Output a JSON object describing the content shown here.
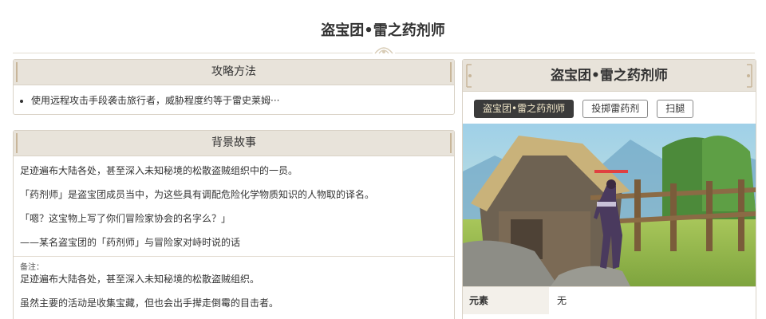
{
  "page": {
    "title": "盗宝团•雷之药剂师"
  },
  "strategy": {
    "header": "攻略方法",
    "items": [
      "使用远程攻击手段袭击旅行者，威胁程度约等于雷史莱姆···"
    ]
  },
  "story": {
    "header": "背景故事",
    "paragraphs": [
      "足迹遍布大陆各处，甚至深入未知秘境的松散盗贼组织中的一员。",
      "「药剂师」是盗宝团成员当中，为这些具有调配危险化学物质知识的人物取的译名。",
      "「嗯？这宝物上写了你们冒险家协会的名字么？」",
      "——某名盗宝团的「药剂师」与冒险家对峙时说的话"
    ],
    "note_label": "备注：",
    "notes": [
      "足迹遍布大陆各处，甚至深入未知秘境的松散盗贼组织。",
      "虽然主要的活动是收集宝藏，但也会出手撵走倒霉的目击者。"
    ]
  },
  "infobox": {
    "title": "盗宝团•雷之药剂师",
    "tabs": [
      {
        "label": "盗宝团•雷之药剂师",
        "active": true
      },
      {
        "label": "投掷雷药剂",
        "active": false
      },
      {
        "label": "扫腿",
        "active": false
      }
    ],
    "stats": [
      {
        "key": "元素",
        "value": "无"
      }
    ]
  },
  "colors": {
    "header_bg": "#e8e3da",
    "border": "#d9d2c6",
    "active_tab_bg": "#3b3b3b",
    "active_tab_text": "#f0e6c8"
  }
}
